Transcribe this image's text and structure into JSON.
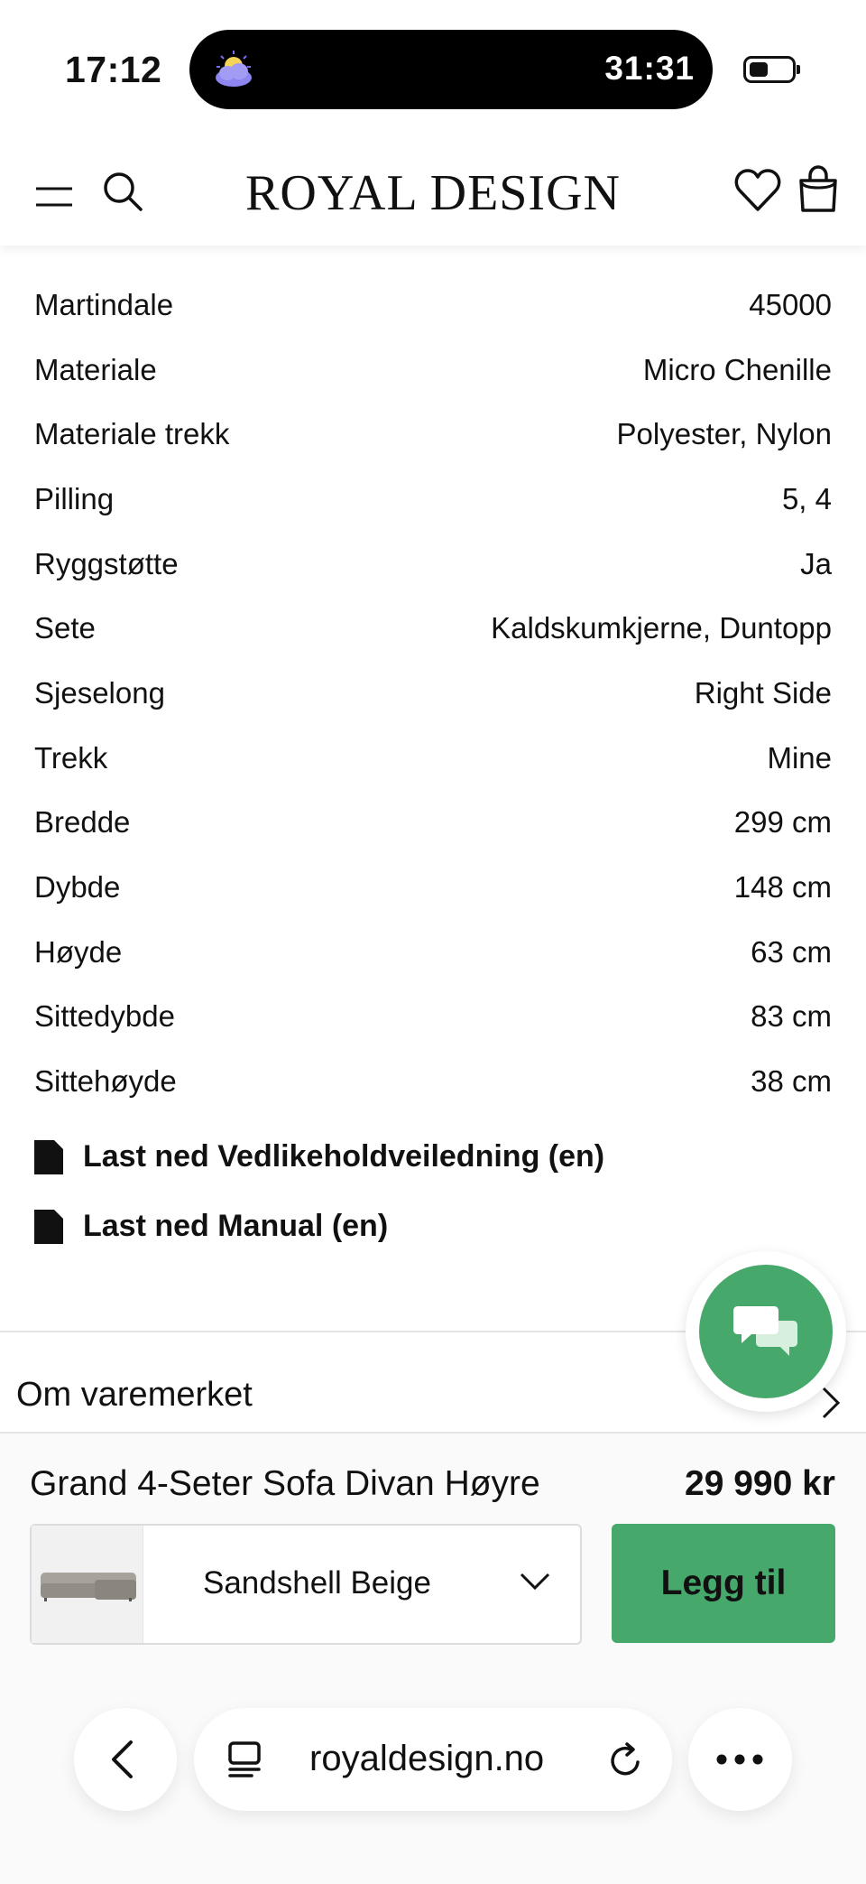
{
  "status_bar": {
    "time": "17:12",
    "timer": "31:31"
  },
  "header": {
    "logo": "ROYAL DESIGN"
  },
  "specs": [
    {
      "label": "Martindale",
      "value": "45000"
    },
    {
      "label": "Materiale",
      "value": "Micro Chenille"
    },
    {
      "label": "Materiale trekk",
      "value": "Polyester, Nylon"
    },
    {
      "label": "Pilling",
      "value": "5, 4"
    },
    {
      "label": "Ryggstøtte",
      "value": "Ja"
    },
    {
      "label": "Sete",
      "value": "Kaldskumkjerne, Duntopp"
    },
    {
      "label": "Sjeselong",
      "value": "Right Side"
    },
    {
      "label": "Trekk",
      "value": "Mine"
    },
    {
      "label": "Bredde",
      "value": "299 cm"
    },
    {
      "label": "Dybde",
      "value": "148 cm"
    },
    {
      "label": "Høyde",
      "value": "63 cm"
    },
    {
      "label": "Sittedybde",
      "value": "83 cm"
    },
    {
      "label": "Sittehøyde",
      "value": "38 cm"
    }
  ],
  "downloads": {
    "care_guide": "Last ned Vedlikeholdveiledning (en)",
    "manual": "Last ned Manual (en)"
  },
  "brand_section": {
    "title": "Om varemerket"
  },
  "cart_bar": {
    "product_name": "Grand 4-Seter Sofa Divan Høyre",
    "price": "29 990 kr",
    "variant": "Sandshell Beige",
    "add_label": "Legg til"
  },
  "browser": {
    "url": "royaldesign.no"
  },
  "colors": {
    "accent_green": "#47a86b",
    "text": "#111111",
    "divider": "#e4e4e4"
  }
}
